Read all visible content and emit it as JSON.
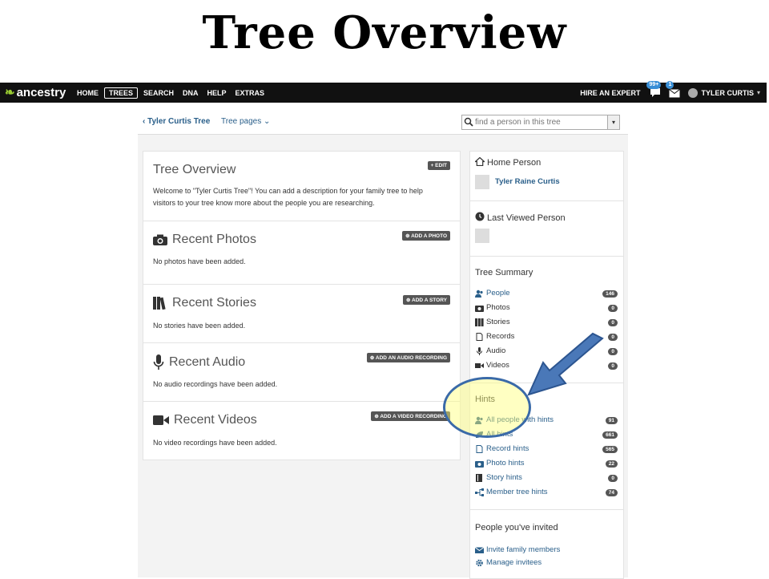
{
  "slide": {
    "title": "Tree Overview"
  },
  "nav": {
    "logo": "ancestry",
    "items": [
      "HOME",
      "TREES",
      "SEARCH",
      "DNA",
      "HELP",
      "EXTRAS"
    ],
    "hire": "HIRE AN EXPERT",
    "messages_badge": "99+",
    "mail_badge": "1",
    "user": "TYLER CURTIS"
  },
  "tree_bar": {
    "tree_name": "Tyler Curtis Tree",
    "tree_pages": "Tree pages",
    "search_placeholder": "find a person in this tree"
  },
  "overview": {
    "title": "Tree Overview",
    "edit": "+ EDIT",
    "description_line1": "Welcome to \"Tyler Curtis Tree\"! You can add a description for your family tree to help",
    "description_line2": "visitors to your tree know more about the people you are researching."
  },
  "photos": {
    "title": "Recent Photos",
    "button": "ADD A PHOTO",
    "empty": "No photos have been added."
  },
  "stories": {
    "title": "Recent Stories",
    "button": "ADD A STORY",
    "empty": "No stories have been added."
  },
  "audio": {
    "title": "Recent Audio",
    "button": "ADD AN AUDIO RECORDING",
    "empty": "No audio recordings have been added."
  },
  "videos": {
    "title": "Recent Videos",
    "button": "ADD A VIDEO RECORDING",
    "empty": "No video recordings have been added."
  },
  "sidebar": {
    "home_person_title": "Home Person",
    "home_person_name": "Tyler Raine Curtis",
    "last_viewed_title": "Last Viewed Person",
    "summary_title": "Tree Summary",
    "summary": [
      {
        "label": "People",
        "count": "146",
        "icon": "people-icon"
      },
      {
        "label": "Photos",
        "count": "0",
        "icon": "camera-icon"
      },
      {
        "label": "Stories",
        "count": "0",
        "icon": "books-icon"
      },
      {
        "label": "Records",
        "count": "0",
        "icon": "document-icon"
      },
      {
        "label": "Audio",
        "count": "0",
        "icon": "microphone-icon"
      },
      {
        "label": "Videos",
        "count": "0",
        "icon": "video-icon"
      }
    ],
    "hints_title": "Hints",
    "hints": [
      {
        "label": "All people with hints",
        "count": "91",
        "icon": "people-icon"
      },
      {
        "label": "All hints",
        "count": "661",
        "icon": "leaf-icon"
      },
      {
        "label": "Record hints",
        "count": "565",
        "icon": "document-icon"
      },
      {
        "label": "Photo hints",
        "count": "22",
        "icon": "camera-icon"
      },
      {
        "label": "Story hints",
        "count": "0",
        "icon": "book-icon"
      },
      {
        "label": "Member tree hints",
        "count": "74",
        "icon": "tree-icon"
      }
    ],
    "invited_title": "People you've invited",
    "invite_link": "Invite family members",
    "manage_link": "Manage invitees"
  },
  "colors": {
    "nav_bg": "#111111",
    "link": "#2a5f8a",
    "badge": "#555555",
    "highlight": "#ffff78",
    "arrow": "#4a78b8"
  }
}
